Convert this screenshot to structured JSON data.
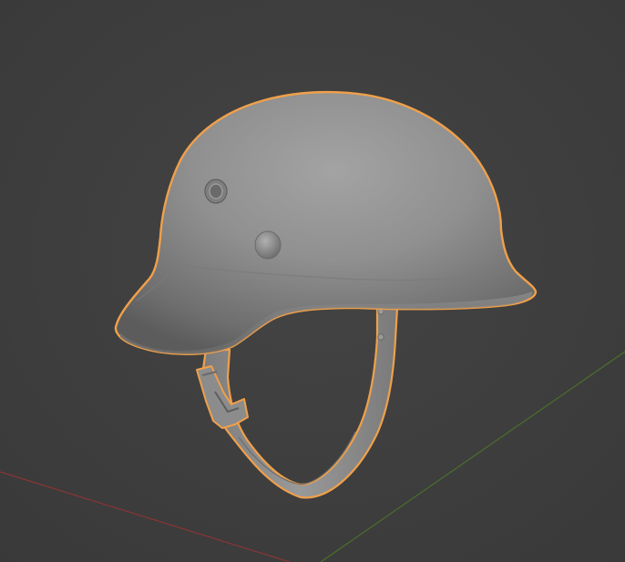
{
  "viewport": {
    "background_color": "#3d3d3d",
    "grid_color": "#444444",
    "x_axis_color": "#8a3535",
    "y_axis_color": "#4b6f2c"
  },
  "object": {
    "name": "helmet",
    "selected": true,
    "outline_color": "#f0a04a",
    "shell_color": "#8e8e8e",
    "strap_color": "#8a8a8a"
  }
}
